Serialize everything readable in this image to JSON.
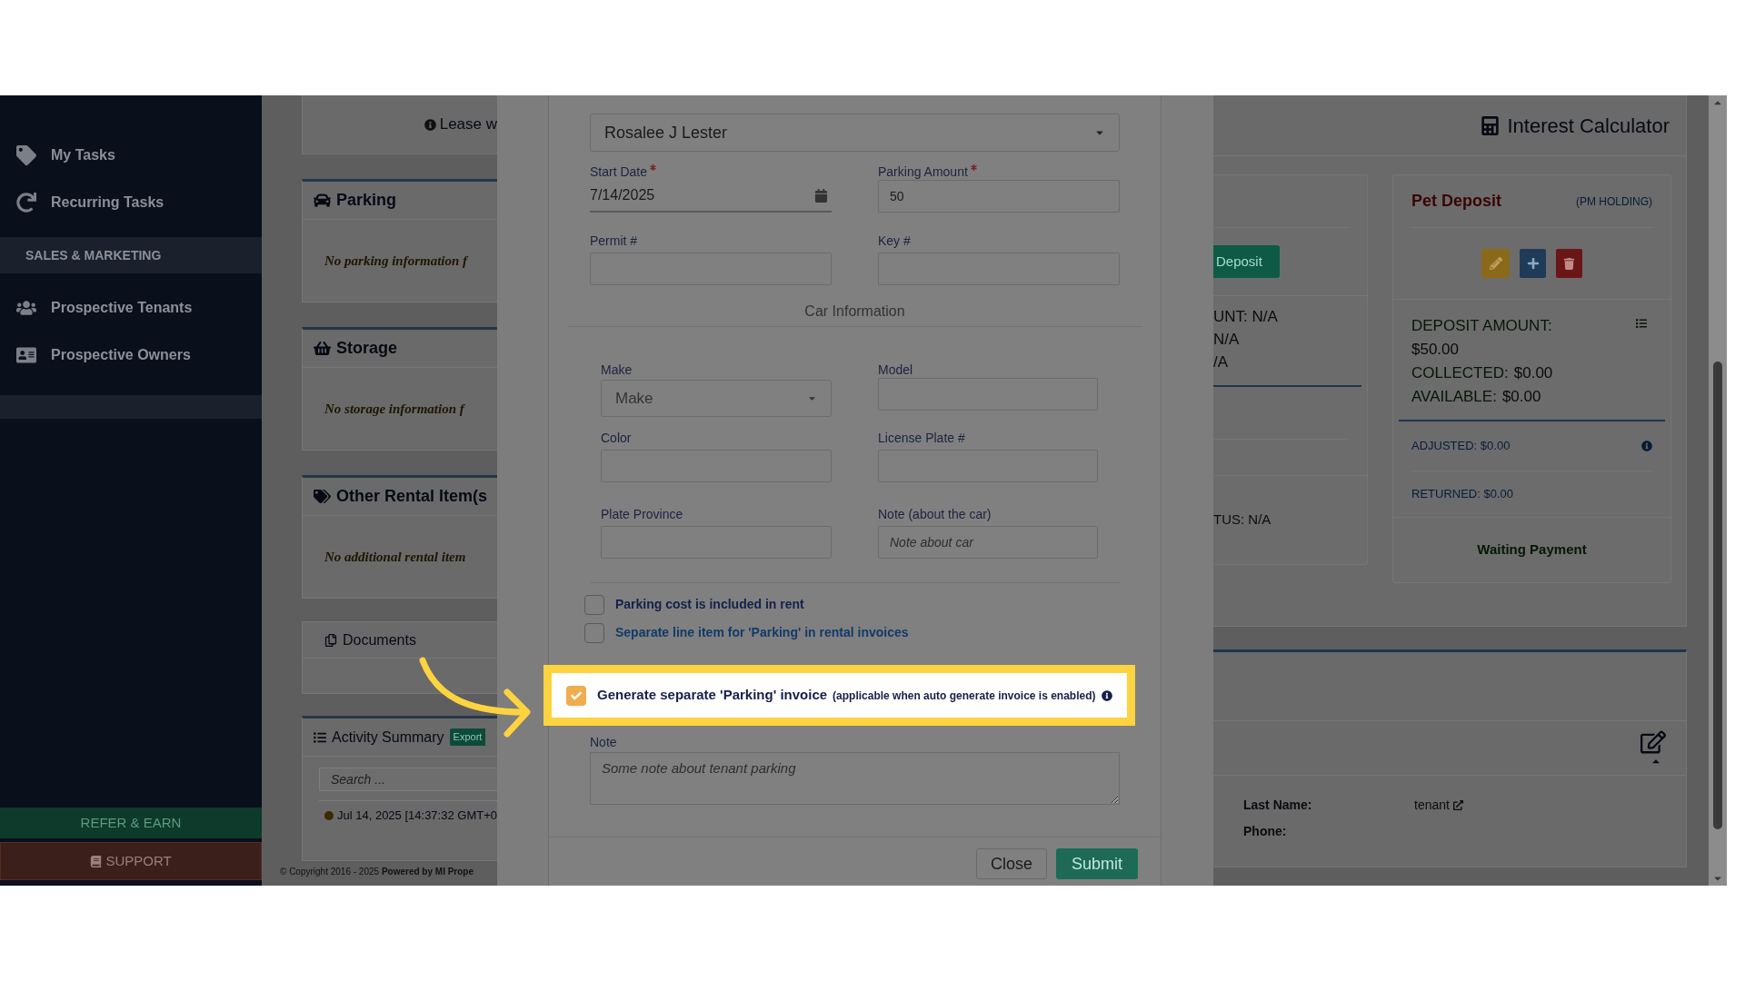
{
  "sidebar": {
    "items": [
      {
        "kind": "link",
        "label": "My Tasks"
      },
      {
        "kind": "link",
        "label": "Recurring Tasks"
      },
      {
        "kind": "section",
        "label": "SALES & MARKETING"
      },
      {
        "kind": "link",
        "label": "Prospective Tenants"
      },
      {
        "kind": "link",
        "label": "Prospective Owners"
      }
    ],
    "buttons": [
      {
        "kind": "refer",
        "label": "REFER & EARN"
      },
      {
        "kind": "support",
        "label": "SUPPORT"
      }
    ]
  },
  "background": {
    "lease_notice": "Lease w",
    "panels": [
      {
        "title": "Parking",
        "message": "No parking information f"
      },
      {
        "title": "Storage",
        "message": "No storage information f"
      },
      {
        "title": "Other Rental Item(s",
        "message": "No additional rental item"
      }
    ],
    "documents": {
      "title": "Documents"
    },
    "activity": {
      "title": "Activity Summary",
      "badge": "Export",
      "search_placeholder": "Search ...",
      "entry": "Jul 14, 2025 [14:37:32 GMT+0"
    },
    "copyright": "© Copyright 2016 - 2025 **Powered by MI Prope**"
  },
  "modal": {
    "tenant": "Rosalee J Lester",
    "start_date": {
      "label": "Start Date",
      "required": true,
      "value": "7/14/2025"
    },
    "parking_amount": {
      "label": "Parking Amount",
      "required": true,
      "value": "50"
    },
    "permit": {
      "label": "Permit #"
    },
    "key": {
      "label": "Key #"
    },
    "car_section": "Car Information",
    "make": {
      "label": "Make",
      "placeholder": "Make"
    },
    "model": {
      "label": "Model"
    },
    "color": {
      "label": "Color"
    },
    "license_plate": {
      "label": "License Plate #"
    },
    "plate_province": {
      "label": "Plate Province"
    },
    "car_note": {
      "label": "Note (about the car)",
      "placeholder": "Note about car"
    },
    "checkboxes": [
      {
        "kind": "plain",
        "label": "Parking cost is included in rent",
        "checked": false
      },
      {
        "kind": "link",
        "label": "Separate line item for 'Parking' in rental invoices",
        "checked": false
      },
      {
        "kind": "highlighted",
        "label": "Generate separate 'Parking' invoice",
        "note": "(applicable when auto generate invoice is enabled)",
        "checked": true
      }
    ],
    "note": {
      "label": "Note",
      "placeholder": "Some note about tenant parking"
    },
    "buttons": [
      {
        "kind": "secondary",
        "label": "Close"
      },
      {
        "kind": "primary",
        "label": "Submit"
      }
    ]
  },
  "right": {
    "interest_calculator": "Interest Calculator",
    "deposit_card": {
      "button": "Deposit",
      "lines": [
        "UNT: N/A",
        "N/A",
        "/A"
      ],
      "status": "TUS: N/A"
    },
    "pet_deposit": {
      "title": "Pet Deposit",
      "holding": "(PM HOLDING)",
      "summary": [
        {
          "label": "DEPOSIT AMOUNT:",
          "value": "$50.00"
        },
        {
          "label": "COLLECTED:",
          "value": "$0.00"
        },
        {
          "label": "AVAILABLE:",
          "value": "$0.00"
        }
      ],
      "adjusted": "ADJUSTED: $0.00",
      "returned": "RETURNED: $0.00",
      "status": "Waiting Payment"
    },
    "tenant_fields": [
      {
        "label": "Last Name:",
        "value": "tenant"
      },
      {
        "label": "Phone:"
      }
    ]
  }
}
